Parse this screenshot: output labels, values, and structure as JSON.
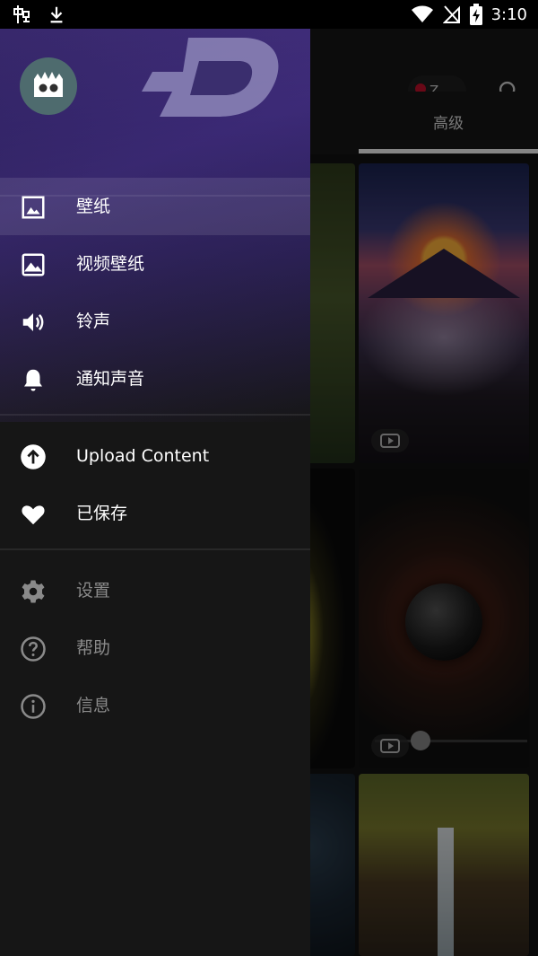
{
  "status_bar": {
    "time": "3:10",
    "left_icons": [
      "app-notification-icon",
      "download-icon"
    ],
    "right_icons": [
      "wifi-icon",
      "no-sim-icon",
      "battery-charging-icon"
    ]
  },
  "app_bar": {
    "account_initial": "Z ˬ",
    "account_dot_color": "#c0102a",
    "search_icon": "search-icon"
  },
  "tabs": {
    "advanced": "高级"
  },
  "drawer": {
    "logo_icon": "zedge-logo",
    "avatar_icon": "monster-avatar-icon",
    "primary_items": [
      {
        "label": "壁纸",
        "icon": "image-icon",
        "selected": true
      },
      {
        "label": "视频壁纸",
        "icon": "landscape-icon",
        "selected": false
      },
      {
        "label": "铃声",
        "icon": "volume-icon",
        "selected": false
      },
      {
        "label": "通知声音",
        "icon": "bell-icon",
        "selected": false
      }
    ],
    "secondary_items": [
      {
        "label": "Upload Content",
        "icon": "upload-circle-icon"
      },
      {
        "label": "已保存",
        "icon": "heart-icon"
      }
    ],
    "tertiary_items": [
      {
        "label": "设置",
        "icon": "gear-icon"
      },
      {
        "label": "帮助",
        "icon": "help-circle-icon"
      },
      {
        "label": "信息",
        "icon": "info-circle-icon"
      }
    ]
  },
  "colors": {
    "drawer_accent": "#3a2a6e",
    "text_primary": "#ffffff",
    "text_dim": "#8a8a8a"
  }
}
